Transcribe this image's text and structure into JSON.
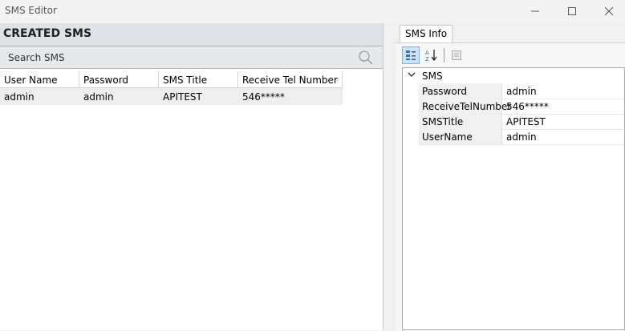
{
  "window": {
    "title": "SMS Editor"
  },
  "left": {
    "title": "CREATED SMS",
    "search": {
      "placeholder": "Search SMS",
      "value": ""
    },
    "columns": [
      "User Name",
      "Password",
      "SMS Title",
      "Receive Tel Number"
    ],
    "rows": [
      [
        "admin",
        "admin",
        "APITEST",
        "546*****"
      ]
    ]
  },
  "right": {
    "tab": "SMS Info",
    "category": "SMS",
    "properties": [
      {
        "name": "Password",
        "value": "admin"
      },
      {
        "name": "ReceiveTelNumber",
        "value": "546*****"
      },
      {
        "name": "SMSTitle",
        "value": "APITEST"
      },
      {
        "name": "UserName",
        "value": "admin"
      }
    ]
  }
}
